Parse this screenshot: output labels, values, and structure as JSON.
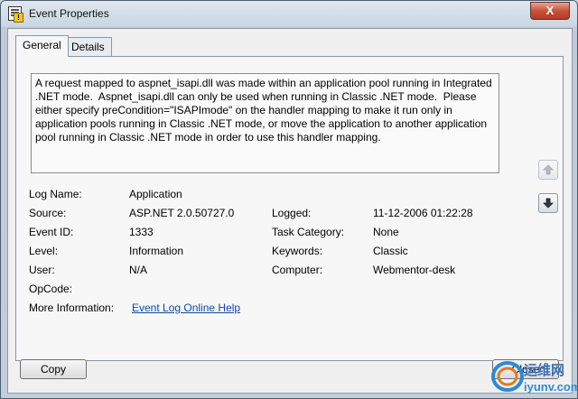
{
  "window": {
    "title": "Event Properties",
    "close_glyph": "X"
  },
  "tabs": [
    {
      "label": "General",
      "active": true
    },
    {
      "label": "Details",
      "active": false
    }
  ],
  "description": "A request mapped to aspnet_isapi.dll was made within an application pool running in Integrated .NET mode.  Aspnet_isapi.dll can only be used when running in Classic .NET mode.  Please either specify preCondition=\"ISAPImode\" on the handler mapping to make it run only in application pools running in Classic .NET mode, or move the application to another application pool running in Classic .NET mode in order to use this handler mapping.",
  "fields": {
    "log_name": {
      "label": "Log Name:",
      "value": "Application"
    },
    "source": {
      "label": "Source:",
      "value": "ASP.NET 2.0.50727.0"
    },
    "event_id": {
      "label": "Event ID:",
      "value": "1333"
    },
    "level": {
      "label": "Level:",
      "value": "Information"
    },
    "user": {
      "label": "User:",
      "value": "N/A"
    },
    "opcode": {
      "label": "OpCode:",
      "value": ""
    },
    "more_info": {
      "label": "More Information:",
      "link": "Event Log Online Help"
    },
    "logged": {
      "label": "Logged:",
      "value": "11-12-2006 01:22:28"
    },
    "task_category": {
      "label": "Task Category:",
      "value": "None"
    },
    "keywords": {
      "label": "Keywords:",
      "value": "Classic"
    },
    "computer": {
      "label": "Computer:",
      "value": "Webmentor-desk"
    }
  },
  "nav": {
    "previous_icon": "arrow-up-icon",
    "next_icon": "arrow-down-icon"
  },
  "buttons": {
    "copy": "Copy",
    "close": "Close"
  },
  "watermark": {
    "text": "运维网",
    "url": "iyunv.com"
  }
}
